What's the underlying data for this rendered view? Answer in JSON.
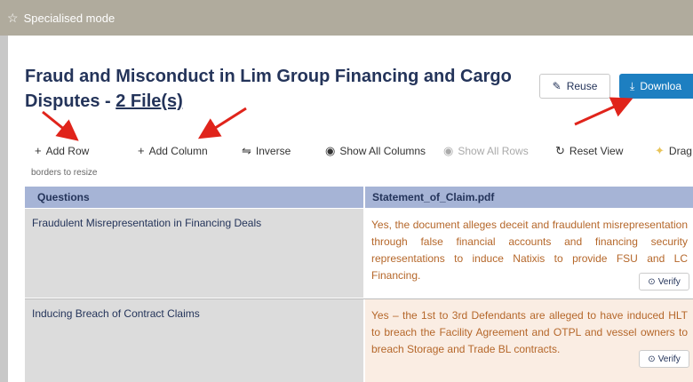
{
  "mode_bar": {
    "label": "Specialised mode",
    "icon": "star-icon"
  },
  "title": {
    "main": "Fraud and Misconduct in Lim Group Financing and Cargo Disputes - ",
    "files": "2 File(s)"
  },
  "actions": {
    "reuse": "Reuse",
    "download": "Downloa"
  },
  "toolbar": {
    "add_row": "Add Row",
    "add_column": "Add Column",
    "inverse": "Inverse",
    "show_all_columns": "Show All Columns",
    "show_all_rows": "Show All Rows",
    "reset_view": "Reset View",
    "drag_hint": "Drag",
    "borders_hint": "borders to resize"
  },
  "table": {
    "headers": [
      "Questions",
      "Statement_of_Claim.pdf"
    ],
    "rows": [
      {
        "question": "Fraudulent Misrepresentation in Financing Deals",
        "answer": "Yes, the document alleges deceit and fraudulent misrepresentation through false financial accounts and financing security representations to induce Natixis to provide FSU and LC Financing.",
        "verify": "Verify"
      },
      {
        "question": "Inducing Breach of Contract Claims",
        "answer": "Yes – the 1st to 3rd Defendants are alleged to have induced HLT to breach the Facility Agreement and OTPL and vessel owners to breach Storage and Trade BL contracts.",
        "verify": "Verify"
      }
    ]
  },
  "colors": {
    "accent": "#1d7fc1",
    "title": "#24345a",
    "answer_text": "#b5672a",
    "header_bg": "#a6b4d6",
    "annotation_arrow": "#e0241b"
  }
}
